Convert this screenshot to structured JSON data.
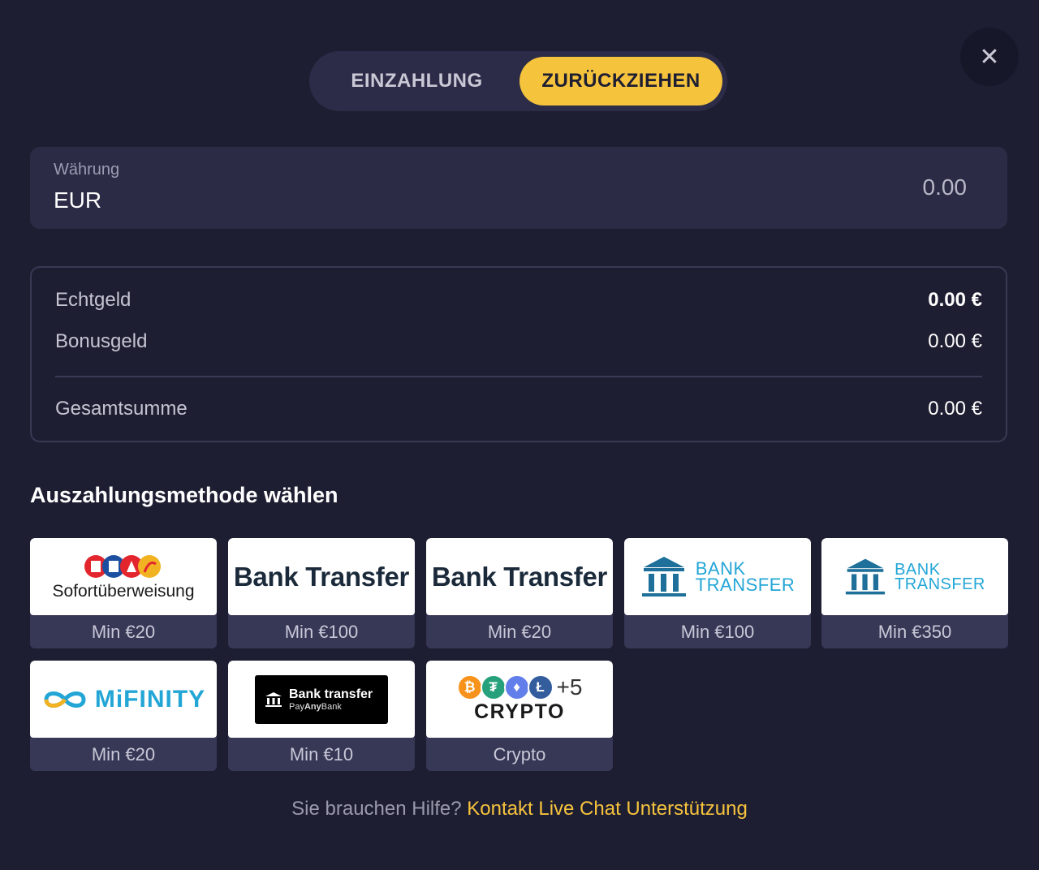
{
  "tabs": {
    "deposit": "EINZAHLUNG",
    "withdraw": "ZURÜCKZIEHEN"
  },
  "currency": {
    "label": "Währung",
    "value": "EUR",
    "amount": "0.00"
  },
  "balance": {
    "rows": [
      {
        "label": "Echtgeld",
        "value": "0.00 €"
      },
      {
        "label": "Bonusgeld",
        "value": "0.00 €"
      }
    ],
    "total": {
      "label": "Gesamtsumme",
      "value": "0.00 €"
    }
  },
  "section_title": "Auszahlungsmethode wählen",
  "methods": [
    {
      "name": "Sofortüberweisung",
      "min": "Min €20"
    },
    {
      "name": "Bank Transfer",
      "min": "Min €100"
    },
    {
      "name": "Bank Transfer",
      "min": "Min €20"
    },
    {
      "name_line1": "BANK",
      "name_line2": "TRANSFER",
      "min": "Min €100"
    },
    {
      "name_line1": "BANK",
      "name_line2": "TRANSFER",
      "min": "Min €350"
    },
    {
      "name": "MiFINITY",
      "min": "Min €20"
    },
    {
      "name": "Bank transfer",
      "sub_pay": "Pay",
      "sub_any": "Any",
      "sub_bank": "Bank",
      "min": "Min €10"
    },
    {
      "plus": "+5",
      "name": "CRYPTO",
      "min": "Crypto"
    }
  ],
  "help": {
    "question": "Sie brauchen Hilfe?",
    "link": "Kontakt Live Chat Unterstützung"
  },
  "icons": {
    "close": "close-icon",
    "bank": "bank-building-icon",
    "mifinity": "infinity-icon",
    "coins": [
      "bitcoin-icon",
      "tether-icon",
      "ethereum-icon",
      "litecoin-icon"
    ]
  },
  "colors": {
    "accent": "#f6c33d",
    "background": "#1e1e32",
    "panel": "#2b2b46",
    "bank_blue": "#23a6d6"
  }
}
